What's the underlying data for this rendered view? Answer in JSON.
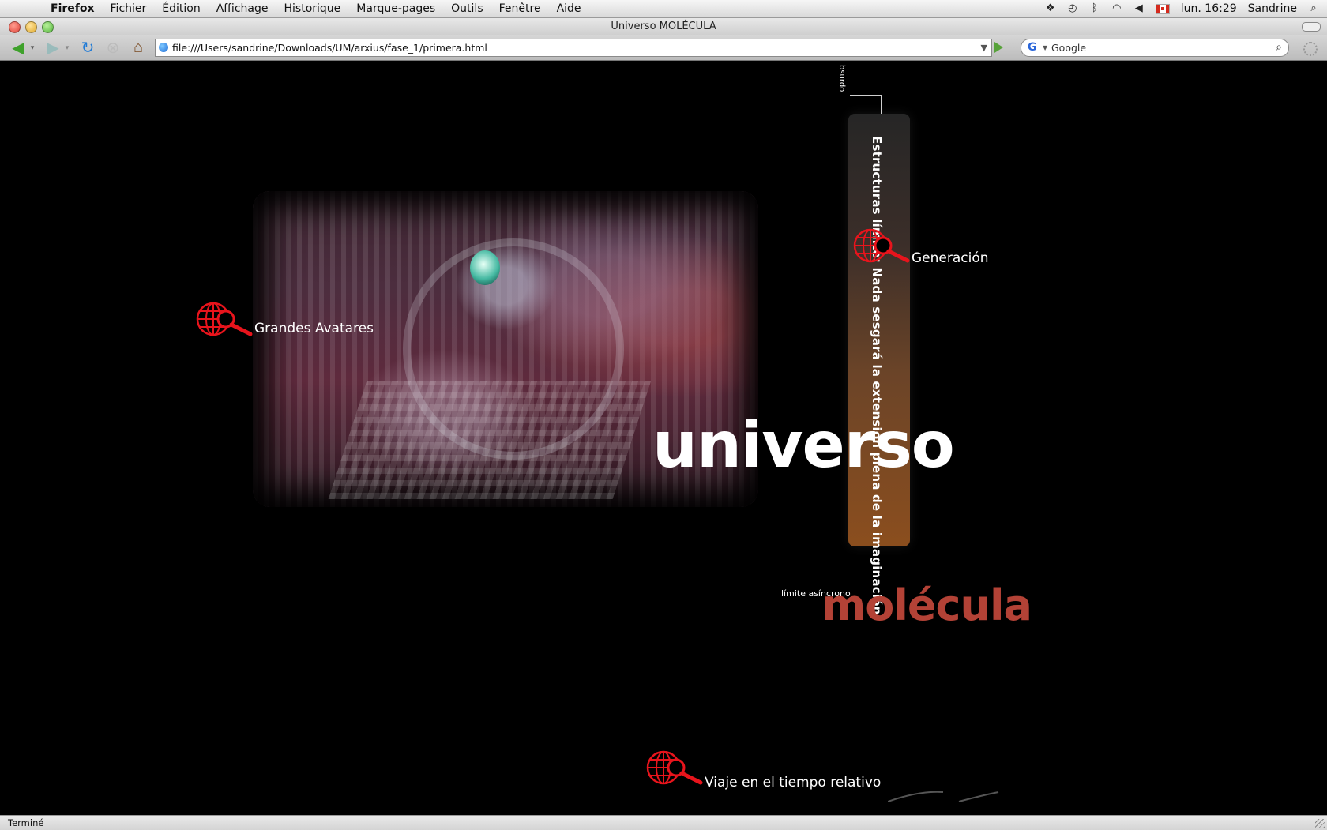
{
  "menubar": {
    "app": "Firefox",
    "items": [
      "Fichier",
      "Édition",
      "Affichage",
      "Historique",
      "Marque-pages",
      "Outils",
      "Fenêtre",
      "Aide"
    ],
    "clock": "lun. 16:29",
    "user": "Sandrine"
  },
  "window": {
    "title": "Universo MOLÉCULA"
  },
  "toolbar": {
    "url": "file:///Users/sandrine/Downloads/UM/arxius/fase_1/primera.html",
    "search_placeholder": "Google"
  },
  "page": {
    "links": {
      "grandes": "Grandes Avatares",
      "generacion": "Generación",
      "viaje": "Viaje en el tiempo relativo"
    },
    "brand_top": "universo",
    "brand_bottom": "molécula",
    "vertical_text": "Estructuras límite: Nada sesgará la extensión plena de la imaginación.",
    "absurdo": "bsurdo",
    "limite": "límite asíncrono"
  },
  "statusbar": {
    "text": "Terminé"
  },
  "colors": {
    "accent": "#e8141c",
    "brand_red": "#b34236",
    "bar_bottom": "#8b4e1e"
  }
}
